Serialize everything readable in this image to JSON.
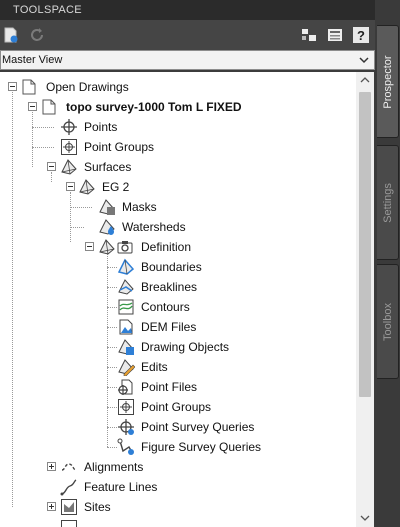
{
  "app": {
    "title": "TOOLSPACE"
  },
  "view": {
    "selected": "Master View"
  },
  "side_tabs": [
    "Prospector",
    "Settings",
    "Toolbox"
  ],
  "tree": {
    "open_drawings": "Open Drawings",
    "drawing": "topo survey-1000 Tom L FIXED",
    "points": "Points",
    "point_groups": "Point Groups",
    "surfaces": "Surfaces",
    "eg2": "EG 2",
    "masks": "Masks",
    "watersheds": "Watersheds",
    "definition": "Definition",
    "boundaries": "Boundaries",
    "breaklines": "Breaklines",
    "contours": "Contours",
    "dem_files": "DEM Files",
    "drawing_objects": "Drawing Objects",
    "edits": "Edits",
    "point_files": "Point Files",
    "def_point_groups": "Point Groups",
    "point_survey_queries": "Point Survey Queries",
    "figure_survey_queries": "Figure Survey Queries",
    "alignments": "Alignments",
    "feature_lines": "Feature Lines",
    "sites": "Sites"
  },
  "colors": {
    "accent_blue": "#2e7fd6",
    "surface_green": "#3a9a4a",
    "edit_orange": "#e8a030"
  }
}
